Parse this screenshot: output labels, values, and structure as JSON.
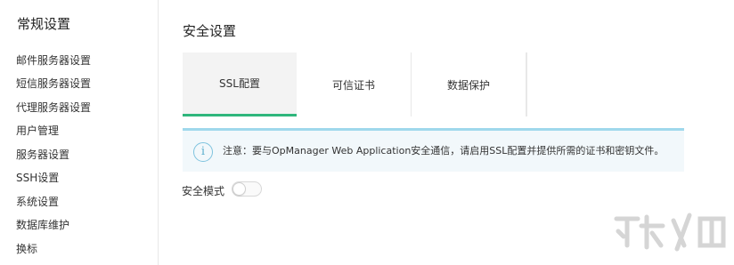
{
  "sidebar": {
    "title": "常规设置",
    "items": [
      {
        "label": "邮件服务器设置"
      },
      {
        "label": "短信服务器设置"
      },
      {
        "label": "代理服务器设置"
      },
      {
        "label": "用户管理"
      },
      {
        "label": "服务器设置"
      },
      {
        "label": "SSH设置"
      },
      {
        "label": "系统设置"
      },
      {
        "label": "数据库维护"
      },
      {
        "label": "换标"
      }
    ]
  },
  "main": {
    "title": "安全设置",
    "tabs": [
      {
        "label": "SSL配置",
        "active": true
      },
      {
        "label": "可信证书",
        "active": false
      },
      {
        "label": "数据保护",
        "active": false
      }
    ],
    "notice": {
      "icon": "info-icon",
      "text": "注意：要与OpManager Web Application安全通信，请启用SSL配置并提供所需的证书和密钥文件。"
    },
    "secure_mode": {
      "label": "安全模式",
      "enabled": false
    }
  },
  "colors": {
    "accent": "#2fb67c",
    "notice_border": "#9fd8ec",
    "notice_bg": "#f2f8fb"
  }
}
